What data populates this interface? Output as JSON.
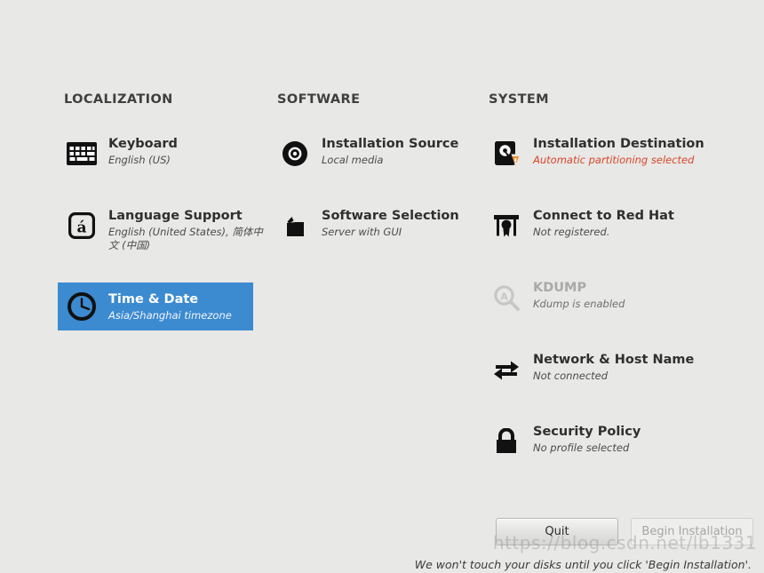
{
  "colors": {
    "background": "#e8e8e6",
    "selection": "#3c8ad0",
    "warning_text": "#d9442a",
    "warning_badge": "#ef8b26",
    "disabled_text": "#a9a9a7"
  },
  "columns": [
    {
      "id": "localization",
      "title": "LOCALIZATION",
      "items": [
        {
          "icon": "keyboard-icon",
          "title": "Keyboard",
          "subtitle": "English (US)",
          "state": "normal"
        },
        {
          "icon": "language-support-icon",
          "title": "Language Support",
          "subtitle": "English (United States), 简体中文 (中国)",
          "state": "normal"
        },
        {
          "icon": "clock-icon",
          "title": "Time & Date",
          "subtitle": "Asia/Shanghai timezone",
          "state": "selected"
        }
      ]
    },
    {
      "id": "software",
      "title": "SOFTWARE",
      "items": [
        {
          "icon": "optical-disc-icon",
          "title": "Installation Source",
          "subtitle": "Local media",
          "state": "normal"
        },
        {
          "icon": "package-icon",
          "title": "Software Selection",
          "subtitle": "Server with GUI",
          "state": "normal"
        }
      ]
    },
    {
      "id": "system",
      "title": "SYSTEM",
      "items": [
        {
          "icon": "hard-disk-warning-icon",
          "title": "Installation Destination",
          "subtitle": "Automatic partitioning selected",
          "state": "warning"
        },
        {
          "icon": "red-hat-icon",
          "title": "Connect to Red Hat",
          "subtitle": "Not registered.",
          "state": "normal"
        },
        {
          "icon": "magnifier-icon",
          "title": "KDUMP",
          "subtitle": "Kdump is enabled",
          "state": "disabled"
        },
        {
          "icon": "network-arrows-icon",
          "title": "Network & Host Name",
          "subtitle": "Not connected",
          "state": "normal"
        },
        {
          "icon": "lock-icon",
          "title": "Security Policy",
          "subtitle": "No profile selected",
          "state": "normal"
        }
      ]
    }
  ],
  "footer": {
    "quit_label": "Quit",
    "begin_label": "Begin Installation",
    "note": "We won't touch your disks until you click 'Begin Installation'."
  },
  "watermark": "https://blog.csdn.net/lb1331"
}
